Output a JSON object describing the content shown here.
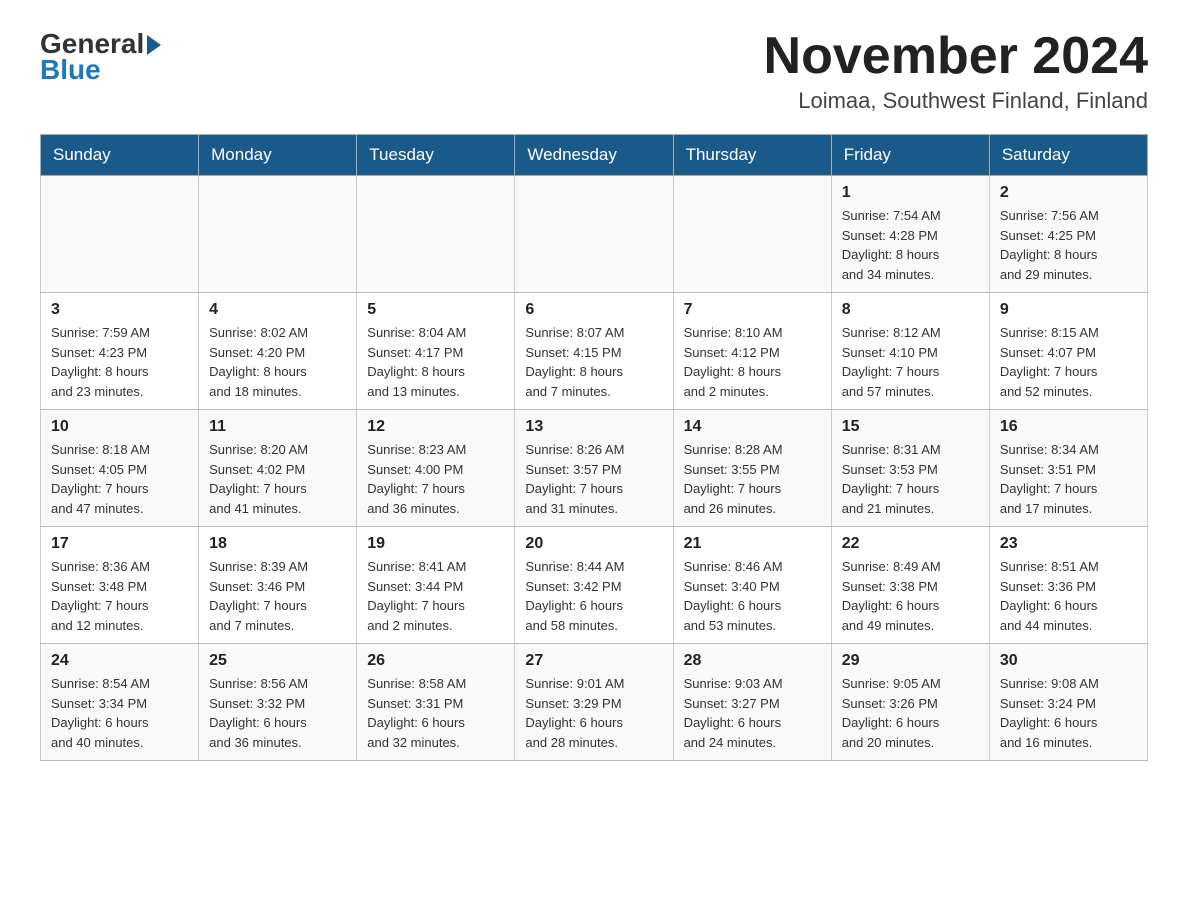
{
  "logo": {
    "general": "General",
    "blue": "Blue"
  },
  "header": {
    "month": "November 2024",
    "location": "Loimaa, Southwest Finland, Finland"
  },
  "weekdays": [
    "Sunday",
    "Monday",
    "Tuesday",
    "Wednesday",
    "Thursday",
    "Friday",
    "Saturday"
  ],
  "weeks": [
    [
      {
        "day": "",
        "info": ""
      },
      {
        "day": "",
        "info": ""
      },
      {
        "day": "",
        "info": ""
      },
      {
        "day": "",
        "info": ""
      },
      {
        "day": "",
        "info": ""
      },
      {
        "day": "1",
        "info": "Sunrise: 7:54 AM\nSunset: 4:28 PM\nDaylight: 8 hours\nand 34 minutes."
      },
      {
        "day": "2",
        "info": "Sunrise: 7:56 AM\nSunset: 4:25 PM\nDaylight: 8 hours\nand 29 minutes."
      }
    ],
    [
      {
        "day": "3",
        "info": "Sunrise: 7:59 AM\nSunset: 4:23 PM\nDaylight: 8 hours\nand 23 minutes."
      },
      {
        "day": "4",
        "info": "Sunrise: 8:02 AM\nSunset: 4:20 PM\nDaylight: 8 hours\nand 18 minutes."
      },
      {
        "day": "5",
        "info": "Sunrise: 8:04 AM\nSunset: 4:17 PM\nDaylight: 8 hours\nand 13 minutes."
      },
      {
        "day": "6",
        "info": "Sunrise: 8:07 AM\nSunset: 4:15 PM\nDaylight: 8 hours\nand 7 minutes."
      },
      {
        "day": "7",
        "info": "Sunrise: 8:10 AM\nSunset: 4:12 PM\nDaylight: 8 hours\nand 2 minutes."
      },
      {
        "day": "8",
        "info": "Sunrise: 8:12 AM\nSunset: 4:10 PM\nDaylight: 7 hours\nand 57 minutes."
      },
      {
        "day": "9",
        "info": "Sunrise: 8:15 AM\nSunset: 4:07 PM\nDaylight: 7 hours\nand 52 minutes."
      }
    ],
    [
      {
        "day": "10",
        "info": "Sunrise: 8:18 AM\nSunset: 4:05 PM\nDaylight: 7 hours\nand 47 minutes."
      },
      {
        "day": "11",
        "info": "Sunrise: 8:20 AM\nSunset: 4:02 PM\nDaylight: 7 hours\nand 41 minutes."
      },
      {
        "day": "12",
        "info": "Sunrise: 8:23 AM\nSunset: 4:00 PM\nDaylight: 7 hours\nand 36 minutes."
      },
      {
        "day": "13",
        "info": "Sunrise: 8:26 AM\nSunset: 3:57 PM\nDaylight: 7 hours\nand 31 minutes."
      },
      {
        "day": "14",
        "info": "Sunrise: 8:28 AM\nSunset: 3:55 PM\nDaylight: 7 hours\nand 26 minutes."
      },
      {
        "day": "15",
        "info": "Sunrise: 8:31 AM\nSunset: 3:53 PM\nDaylight: 7 hours\nand 21 minutes."
      },
      {
        "day": "16",
        "info": "Sunrise: 8:34 AM\nSunset: 3:51 PM\nDaylight: 7 hours\nand 17 minutes."
      }
    ],
    [
      {
        "day": "17",
        "info": "Sunrise: 8:36 AM\nSunset: 3:48 PM\nDaylight: 7 hours\nand 12 minutes."
      },
      {
        "day": "18",
        "info": "Sunrise: 8:39 AM\nSunset: 3:46 PM\nDaylight: 7 hours\nand 7 minutes."
      },
      {
        "day": "19",
        "info": "Sunrise: 8:41 AM\nSunset: 3:44 PM\nDaylight: 7 hours\nand 2 minutes."
      },
      {
        "day": "20",
        "info": "Sunrise: 8:44 AM\nSunset: 3:42 PM\nDaylight: 6 hours\nand 58 minutes."
      },
      {
        "day": "21",
        "info": "Sunrise: 8:46 AM\nSunset: 3:40 PM\nDaylight: 6 hours\nand 53 minutes."
      },
      {
        "day": "22",
        "info": "Sunrise: 8:49 AM\nSunset: 3:38 PM\nDaylight: 6 hours\nand 49 minutes."
      },
      {
        "day": "23",
        "info": "Sunrise: 8:51 AM\nSunset: 3:36 PM\nDaylight: 6 hours\nand 44 minutes."
      }
    ],
    [
      {
        "day": "24",
        "info": "Sunrise: 8:54 AM\nSunset: 3:34 PM\nDaylight: 6 hours\nand 40 minutes."
      },
      {
        "day": "25",
        "info": "Sunrise: 8:56 AM\nSunset: 3:32 PM\nDaylight: 6 hours\nand 36 minutes."
      },
      {
        "day": "26",
        "info": "Sunrise: 8:58 AM\nSunset: 3:31 PM\nDaylight: 6 hours\nand 32 minutes."
      },
      {
        "day": "27",
        "info": "Sunrise: 9:01 AM\nSunset: 3:29 PM\nDaylight: 6 hours\nand 28 minutes."
      },
      {
        "day": "28",
        "info": "Sunrise: 9:03 AM\nSunset: 3:27 PM\nDaylight: 6 hours\nand 24 minutes."
      },
      {
        "day": "29",
        "info": "Sunrise: 9:05 AM\nSunset: 3:26 PM\nDaylight: 6 hours\nand 20 minutes."
      },
      {
        "day": "30",
        "info": "Sunrise: 9:08 AM\nSunset: 3:24 PM\nDaylight: 6 hours\nand 16 minutes."
      }
    ]
  ]
}
